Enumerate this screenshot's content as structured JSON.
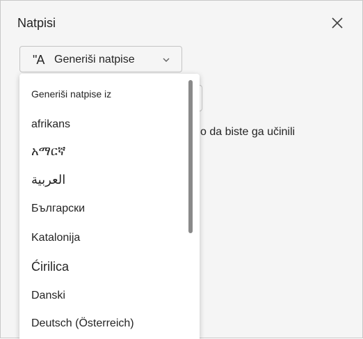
{
  "panel": {
    "title": "Natpisi"
  },
  "generate_button": {
    "icon_glyph": "\"A",
    "label": "Generiši natpise"
  },
  "background_text": "o da biste ga učinili",
  "dropdown": {
    "header": "Generiši natpise iz",
    "items": [
      "afrikans",
      "አማርኛ",
      "العربية",
      "Български",
      "Katalonija",
      "Ćirilica",
      "Danski",
      "Deutsch (Österreich)"
    ]
  }
}
